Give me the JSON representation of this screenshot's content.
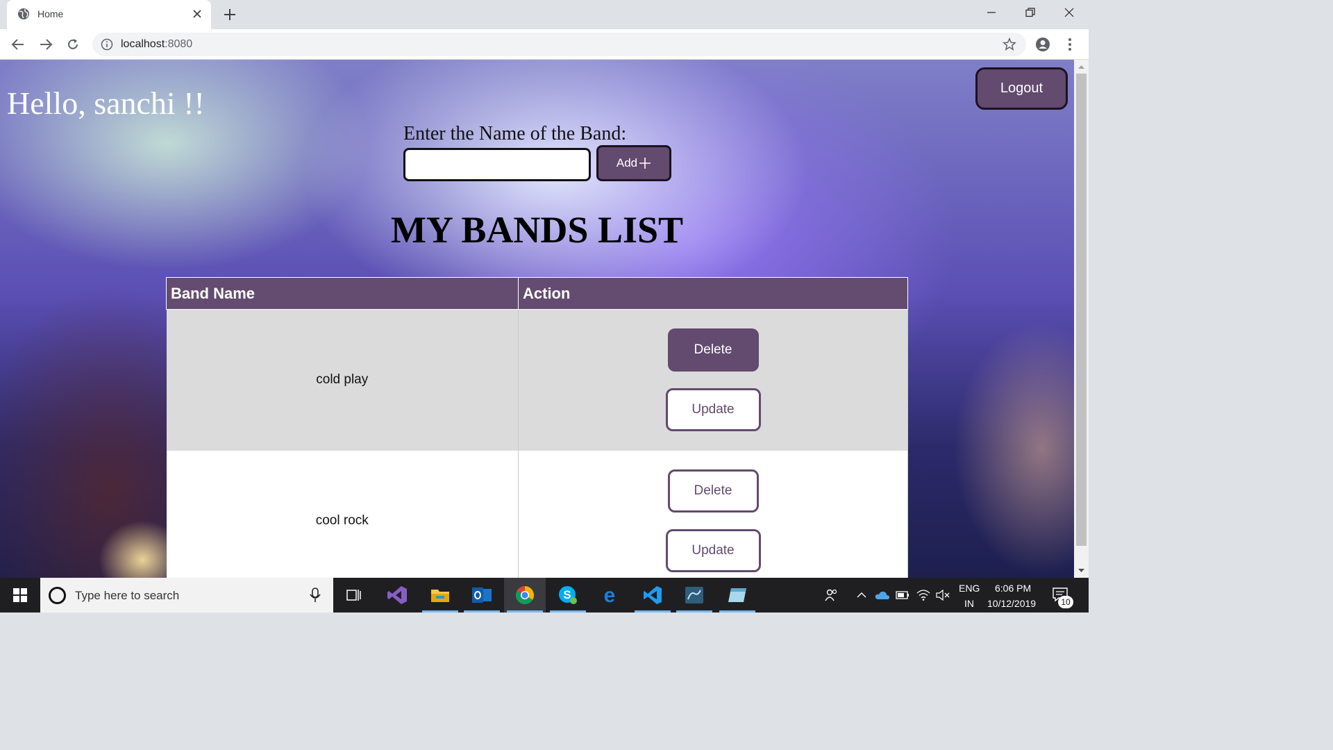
{
  "browser": {
    "tab_title": "Home",
    "url_host": "localhost",
    "url_port": ":8080"
  },
  "page": {
    "greeting": "Hello, sanchi !!",
    "logout_label": "Logout",
    "enter_label": "Enter the Name of the Band:",
    "band_input_value": "",
    "add_label": "Add",
    "list_title": "MY BANDS LIST",
    "table": {
      "headers": [
        "Band Name",
        "Action"
      ],
      "rows": [
        {
          "name": "cold play",
          "delete_label": "Delete",
          "update_label": "Update"
        },
        {
          "name": "cool rock",
          "delete_label": "Delete",
          "update_label": "Update"
        }
      ]
    }
  },
  "taskbar": {
    "search_placeholder": "Type here to search",
    "language": "ENG",
    "region": "IN",
    "time": "6:06 PM",
    "date": "10/12/2019",
    "notification_count": "10"
  },
  "colors": {
    "accent": "#634a6f",
    "header_bg": "#644c70"
  }
}
